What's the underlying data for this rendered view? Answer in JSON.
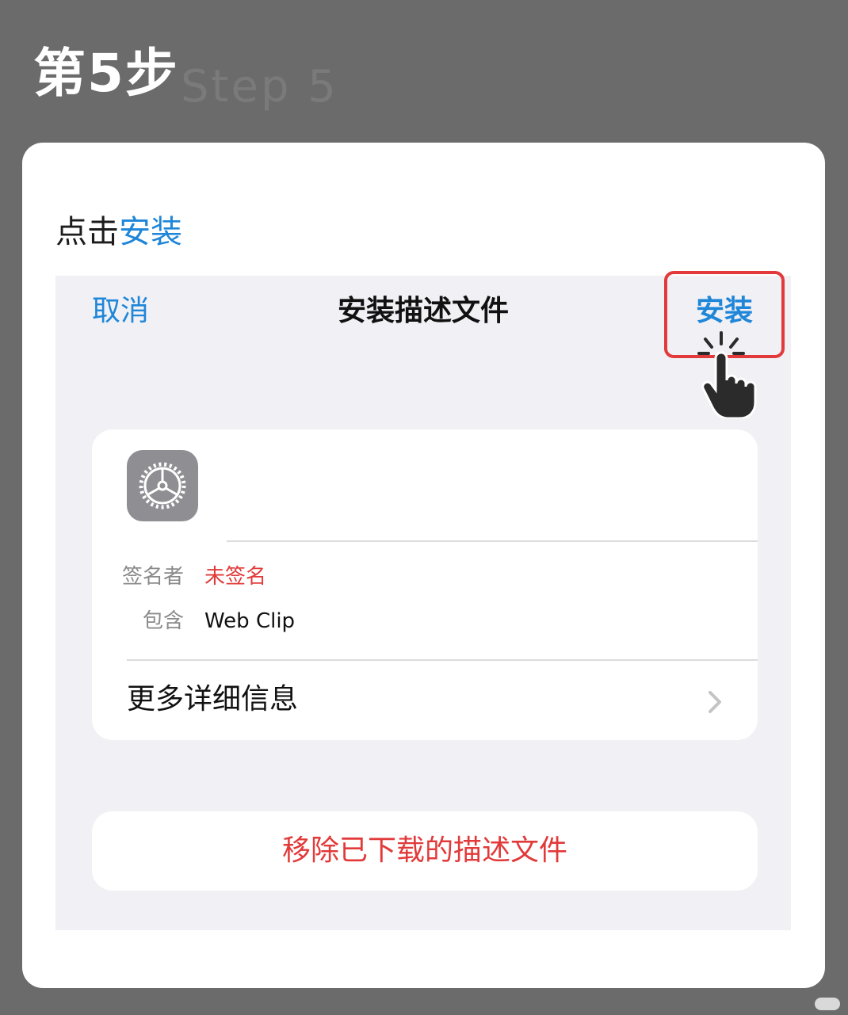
{
  "heading": {
    "title": "第5步",
    "subtitle": "Step 5"
  },
  "instruction": {
    "prefix": "点击",
    "highlight": "安装"
  },
  "nav": {
    "cancel": "取消",
    "title": "安装描述文件",
    "install": "安装"
  },
  "profile": {
    "icon": "gear-icon",
    "rows": [
      {
        "label": "签名者",
        "value": "未签名",
        "value_color": "#e23a3a"
      },
      {
        "label": "包含",
        "value": "Web Clip"
      }
    ],
    "more_details": "更多详细信息"
  },
  "remove_button": "移除已下载的描述文件",
  "colors": {
    "accent": "#1f86d8",
    "danger": "#e23a3a",
    "highlight_box": "#e23a3a"
  }
}
